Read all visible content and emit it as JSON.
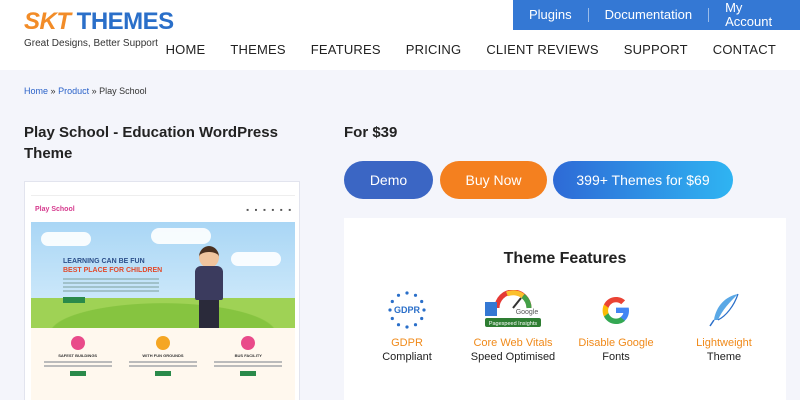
{
  "logo": {
    "brand_a": "SKT",
    "brand_b": "THEMES",
    "tagline": "Great Designs, Better Support"
  },
  "topbar": [
    "Plugins",
    "Documentation",
    "My Account"
  ],
  "nav": [
    "HOME",
    "THEMES",
    "FEATURES",
    "PRICING",
    "CLIENT REVIEWS",
    "SUPPORT",
    "CONTACT"
  ],
  "breadcrumb": {
    "home": "Home",
    "sep": "»",
    "product": "Product",
    "current": "Play School"
  },
  "product": {
    "title": "Play School - Education WordPress Theme"
  },
  "preview": {
    "logo": "Play School",
    "hero_line1": "LEARNING CAN BE FUN",
    "hero_line2": "BEST PLACE FOR CHILDREN",
    "cards": [
      "SAFEST BUILDINGS",
      "WITH FUN GROUNDS",
      "BUS FACILITY"
    ]
  },
  "price": "For $39",
  "buttons": {
    "demo": "Demo",
    "buy": "Buy Now",
    "themes": "399+ Themes for $69"
  },
  "features": {
    "title": "Theme Features",
    "items": [
      {
        "line1": "GDPR",
        "line2": "Compliant",
        "icon": "gdpr-icon",
        "accent": "#f08a1a"
      },
      {
        "line1": "Core Web Vitals",
        "line2": "Speed Optimised",
        "icon": "pagespeed-icon",
        "accent": "#f08a1a"
      },
      {
        "line1": "Disable Google",
        "line2": "Fonts",
        "icon": "google-icon",
        "accent": "#f08a1a"
      },
      {
        "line1": "Lightweight",
        "line2": "Theme",
        "icon": "feather-icon",
        "accent": "#f08a1a"
      }
    ],
    "gdpr_badge": "GDPR",
    "pagespeed_badge": "Pagespeed Insights",
    "google_word": "Google"
  },
  "colors": {
    "primary": "#3478d4",
    "orange": "#f4801f",
    "background": "#f4f5fb"
  }
}
